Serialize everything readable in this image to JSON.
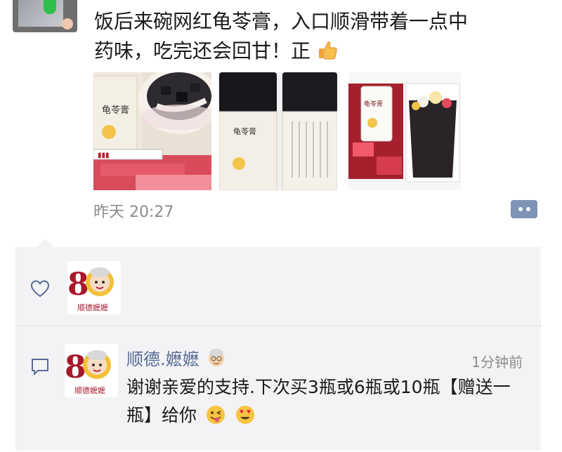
{
  "post": {
    "text_line1": "饭后来碗网红龟苓膏，入口顺滑带着一点中",
    "text_line2": "药味，吃完还会回甘！正",
    "thumbs_up_icon": "thumbs-up-emoji",
    "timestamp": "昨天 20:27",
    "more_icon": "more-dots-icon"
  },
  "photos": [
    {
      "name": "jelly-bowl-photo",
      "jar_label": "龟苓膏"
    },
    {
      "name": "jars-photo",
      "jar_label": "龟苓膏"
    },
    {
      "name": "jar-and-cup-photo",
      "jar_label": "龟苓膏"
    }
  ],
  "likes": {
    "icon": "heart-icon",
    "avatars": [
      {
        "name": "liker-avatar",
        "logo_text": "顺德嬷嬷"
      }
    ]
  },
  "comment": {
    "icon": "comment-icon",
    "author": "顺德.嬷嬷",
    "author_emoji": "granny-emoji",
    "time": "1分钟前",
    "text": "谢谢亲爱的支持.下次买3瓶或6瓶或10瓶【赠送一瓶】给你",
    "emojis": [
      "winking-tongue-emoji",
      "heart-eyes-emoji"
    ]
  },
  "colors": {
    "link_blue": "#576b95",
    "panel_bg": "#f3f3f5",
    "muted": "#8b8b8b"
  }
}
